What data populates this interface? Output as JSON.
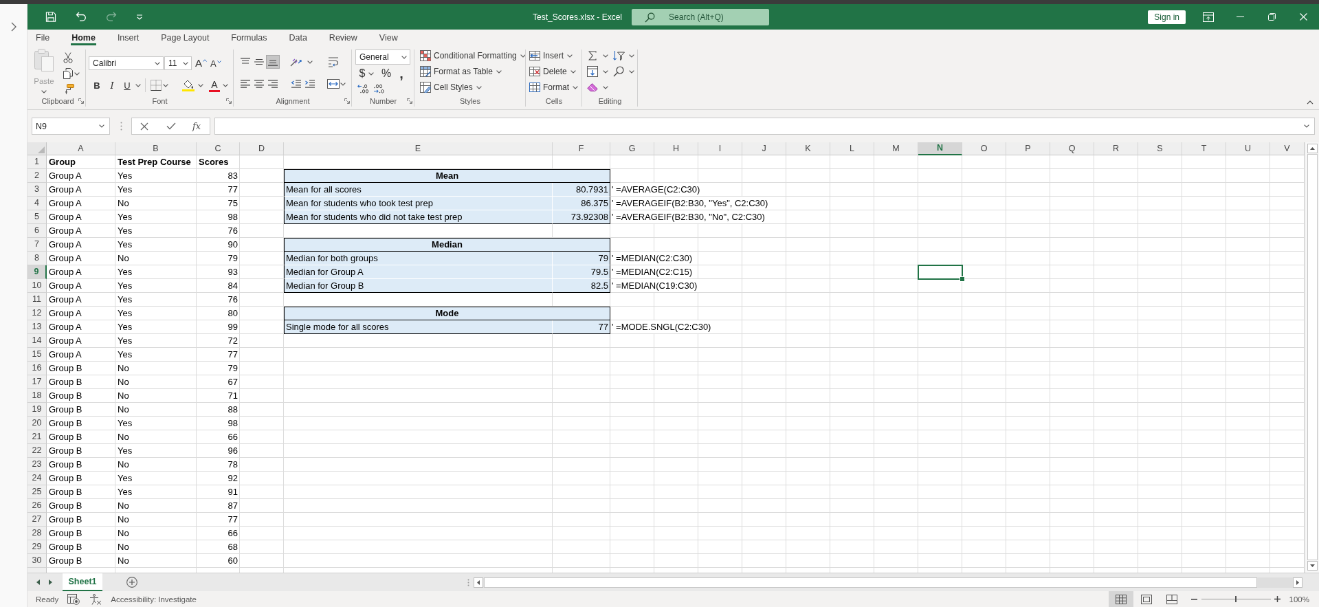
{
  "title_bar": {
    "quick_access": [
      {
        "kind": "save",
        "disabled": false
      },
      {
        "kind": "undo",
        "disabled": false
      },
      {
        "kind": "redo",
        "disabled": true
      },
      {
        "kind": "customize",
        "disabled": false
      }
    ],
    "title": "Test_Scores.xlsx - Excel",
    "search": {
      "placeholder": "Search (Alt+Q)"
    },
    "sign_in": "Sign in"
  },
  "ribbon_tabs": [
    {
      "label": "File",
      "selected": false
    },
    {
      "label": "Home",
      "selected": true
    },
    {
      "label": "Insert",
      "selected": false
    },
    {
      "label": "Page Layout",
      "selected": false
    },
    {
      "label": "Formulas",
      "selected": false
    },
    {
      "label": "Data",
      "selected": false
    },
    {
      "label": "Review",
      "selected": false
    },
    {
      "label": "View",
      "selected": false
    }
  ],
  "ribbon": {
    "clipboard": {
      "label": "Clipboard",
      "paste": {
        "label": "Paste",
        "disabled": true
      }
    },
    "font": {
      "label": "Font",
      "name": "Calibri",
      "size": "11",
      "grow_letter": "A",
      "shrink_letter": "A",
      "bold": "B",
      "italic": "I",
      "underline": "U",
      "color_letter": "A"
    },
    "alignment": {
      "label": "Alignment",
      "vertical": [
        {
          "kind": "top",
          "selected": false
        },
        {
          "kind": "middle",
          "selected": false
        },
        {
          "kind": "bottom",
          "selected": true
        }
      ]
    },
    "number": {
      "label": "Number",
      "format": "General",
      "currency": "$",
      "percent": "%",
      "comma": ","
    },
    "styles": {
      "label": "Styles",
      "items": [
        {
          "kind": "conditional",
          "label": "Conditional Formatting"
        },
        {
          "kind": "table",
          "label": "Format as Table"
        },
        {
          "kind": "cell_styles",
          "label": "Cell Styles"
        }
      ]
    },
    "cells": {
      "label": "Cells",
      "items": [
        {
          "kind": "insert",
          "label": "Insert"
        },
        {
          "kind": "delete",
          "label": "Delete"
        },
        {
          "kind": "format",
          "label": "Format"
        }
      ]
    },
    "editing": {
      "label": "Editing"
    }
  },
  "formula_bar": {
    "name_box": "N9",
    "insert_function": "fx"
  },
  "sheet": {
    "columns": [
      {
        "label": "A",
        "selected": false
      },
      {
        "label": "B",
        "selected": false
      },
      {
        "label": "C",
        "selected": false
      },
      {
        "label": "D",
        "selected": false
      },
      {
        "label": "E",
        "selected": false
      },
      {
        "label": "F",
        "selected": false
      },
      {
        "label": "G",
        "selected": false
      },
      {
        "label": "H",
        "selected": false
      },
      {
        "label": "I",
        "selected": false
      },
      {
        "label": "J",
        "selected": false
      },
      {
        "label": "K",
        "selected": false
      },
      {
        "label": "L",
        "selected": false
      },
      {
        "label": "M",
        "selected": false
      },
      {
        "label": "N",
        "selected": true
      },
      {
        "label": "O",
        "selected": false
      },
      {
        "label": "P",
        "selected": false
      },
      {
        "label": "Q",
        "selected": false
      },
      {
        "label": "R",
        "selected": false
      },
      {
        "label": "S",
        "selected": false
      },
      {
        "label": "T",
        "selected": false
      },
      {
        "label": "U",
        "selected": false
      },
      {
        "label": "V",
        "selected": false
      }
    ],
    "rows": [
      {
        "label": "1",
        "selected": false,
        "kind": "header",
        "cells": [
          "Group",
          "Test Prep Course",
          "Scores"
        ]
      },
      {
        "label": "2",
        "selected": false,
        "kind": "data",
        "cells": [
          "Group A",
          "Yes",
          "83"
        ]
      },
      {
        "label": "3",
        "selected": false,
        "kind": "data",
        "cells": [
          "Group A",
          "Yes",
          "77"
        ]
      },
      {
        "label": "4",
        "selected": false,
        "kind": "data",
        "cells": [
          "Group A",
          "No",
          "75"
        ]
      },
      {
        "label": "5",
        "selected": false,
        "kind": "data",
        "cells": [
          "Group A",
          "Yes",
          "98"
        ]
      },
      {
        "label": "6",
        "selected": false,
        "kind": "data",
        "cells": [
          "Group A",
          "Yes",
          "76"
        ]
      },
      {
        "label": "7",
        "selected": false,
        "kind": "data",
        "cells": [
          "Group A",
          "Yes",
          "90"
        ]
      },
      {
        "label": "8",
        "selected": false,
        "kind": "data",
        "cells": [
          "Group A",
          "No",
          "79"
        ]
      },
      {
        "label": "9",
        "selected": true,
        "kind": "data",
        "cells": [
          "Group A",
          "Yes",
          "93"
        ]
      },
      {
        "label": "10",
        "selected": false,
        "kind": "data",
        "cells": [
          "Group A",
          "Yes",
          "84"
        ]
      },
      {
        "label": "11",
        "selected": false,
        "kind": "data",
        "cells": [
          "Group A",
          "Yes",
          "76"
        ]
      },
      {
        "label": "12",
        "selected": false,
        "kind": "data",
        "cells": [
          "Group A",
          "Yes",
          "80"
        ]
      },
      {
        "label": "13",
        "selected": false,
        "kind": "data",
        "cells": [
          "Group A",
          "Yes",
          "99"
        ]
      },
      {
        "label": "14",
        "selected": false,
        "kind": "data",
        "cells": [
          "Group A",
          "Yes",
          "72"
        ]
      },
      {
        "label": "15",
        "selected": false,
        "kind": "data",
        "cells": [
          "Group A",
          "Yes",
          "77"
        ]
      },
      {
        "label": "16",
        "selected": false,
        "kind": "data",
        "cells": [
          "Group B",
          "No",
          "79"
        ]
      },
      {
        "label": "17",
        "selected": false,
        "kind": "data",
        "cells": [
          "Group B",
          "No",
          "67"
        ]
      },
      {
        "label": "18",
        "selected": false,
        "kind": "data",
        "cells": [
          "Group B",
          "No",
          "71"
        ]
      },
      {
        "label": "19",
        "selected": false,
        "kind": "data",
        "cells": [
          "Group B",
          "No",
          "88"
        ]
      },
      {
        "label": "20",
        "selected": false,
        "kind": "data",
        "cells": [
          "Group B",
          "Yes",
          "98"
        ]
      },
      {
        "label": "21",
        "selected": false,
        "kind": "data",
        "cells": [
          "Group B",
          "No",
          "66"
        ]
      },
      {
        "label": "22",
        "selected": false,
        "kind": "data",
        "cells": [
          "Group B",
          "Yes",
          "96"
        ]
      },
      {
        "label": "23",
        "selected": false,
        "kind": "data",
        "cells": [
          "Group B",
          "No",
          "78"
        ]
      },
      {
        "label": "24",
        "selected": false,
        "kind": "data",
        "cells": [
          "Group B",
          "Yes",
          "92"
        ]
      },
      {
        "label": "25",
        "selected": false,
        "kind": "data",
        "cells": [
          "Group B",
          "Yes",
          "91"
        ]
      },
      {
        "label": "26",
        "selected": false,
        "kind": "data",
        "cells": [
          "Group B",
          "No",
          "87"
        ]
      },
      {
        "label": "27",
        "selected": false,
        "kind": "data",
        "cells": [
          "Group B",
          "No",
          "77"
        ]
      },
      {
        "label": "28",
        "selected": false,
        "kind": "data",
        "cells": [
          "Group B",
          "No",
          "66"
        ]
      },
      {
        "label": "29",
        "selected": false,
        "kind": "data",
        "cells": [
          "Group B",
          "No",
          "68"
        ]
      },
      {
        "label": "30",
        "selected": false,
        "kind": "data",
        "cells": [
          "Group B",
          "No",
          "60"
        ]
      }
    ],
    "summary_tables": [
      {
        "title": "Mean",
        "rows": [
          {
            "label": "Mean for all scores",
            "value": "80.7931",
            "formula": "' =AVERAGE(C2:C30)"
          },
          {
            "label": "Mean for students who took test prep",
            "value": "86.375",
            "formula": "' =AVERAGEIF(B2:B30, \"Yes\", C2:C30)"
          },
          {
            "label": "Mean for students who did not take test prep",
            "value": "73.92308",
            "formula": "' =AVERAGEIF(B2:B30, \"No\", C2:C30)"
          }
        ]
      },
      {
        "title": "Median",
        "rows": [
          {
            "label": "Median for both groups",
            "value": "79",
            "formula": "' =MEDIAN(C2:C30)"
          },
          {
            "label": "Median for Group A",
            "value": "79.5",
            "formula": "' =MEDIAN(C2:C15)"
          },
          {
            "label": "Median for Group B",
            "value": "82.5",
            "formula": "' =MEDIAN(C19:C30)"
          }
        ]
      },
      {
        "title": "Mode",
        "rows": [
          {
            "label": "Single mode for all scores",
            "value": "77",
            "formula": "' =MODE.SNGL(C2:C30)"
          }
        ]
      }
    ]
  },
  "sheet_tabs": [
    {
      "label": "Sheet1",
      "selected": true
    }
  ],
  "status_bar": {
    "status": "Ready",
    "accessibility": "Accessibility: Investigate",
    "views": [
      {
        "kind": "normal",
        "selected": true
      },
      {
        "kind": "page_layout",
        "selected": false
      },
      {
        "kind": "page_break",
        "selected": false
      }
    ],
    "zoom": {
      "level": 0.5,
      "label": "100%"
    }
  }
}
